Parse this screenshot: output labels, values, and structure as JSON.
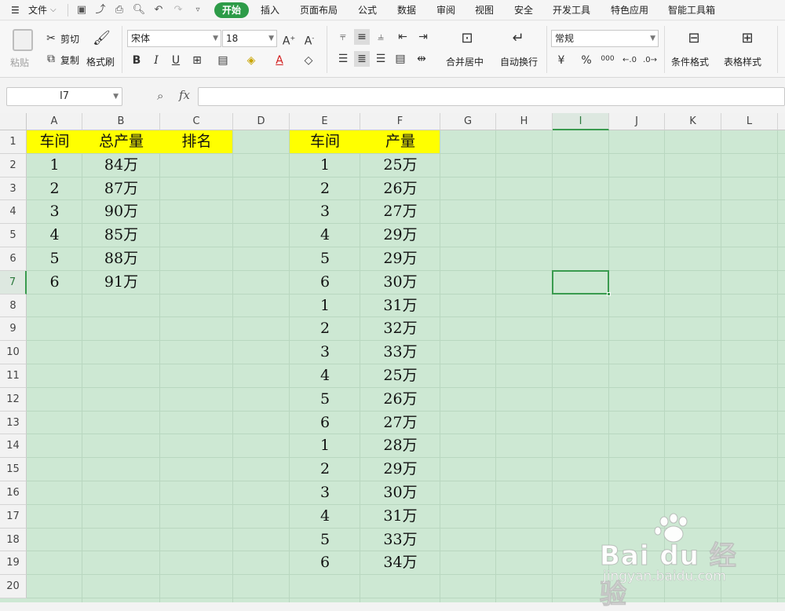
{
  "menu": {
    "file": "文件",
    "tabs": [
      "开始",
      "插入",
      "页面布局",
      "公式",
      "数据",
      "审阅",
      "视图",
      "安全",
      "开发工具",
      "特色应用",
      "智能工具箱"
    ],
    "active_tab": "开始"
  },
  "ribbon": {
    "paste": "粘贴",
    "cut": "剪切",
    "copy": "复制",
    "format_painter": "格式刷",
    "font_name": "宋体",
    "font_size": "18",
    "bold": "B",
    "italic": "I",
    "underline": "U",
    "merge_center": "合并居中",
    "wrap_text": "自动换行",
    "number_format": "常规",
    "percent": "%",
    "thousands": "000",
    "conditional_format": "条件格式",
    "table_style": "表格样式"
  },
  "formula_bar": {
    "name_box": "I7",
    "fx": "fx",
    "content": ""
  },
  "sheet": {
    "columns": [
      "A",
      "B",
      "C",
      "D",
      "E",
      "F",
      "G",
      "H",
      "I",
      "J",
      "K",
      "L"
    ],
    "rows": [
      "1",
      "2",
      "3",
      "4",
      "5",
      "6",
      "7",
      "8",
      "9",
      "10",
      "11",
      "12",
      "13",
      "14",
      "15",
      "16",
      "17",
      "18",
      "19",
      "20"
    ],
    "selected_column": "I",
    "selected_row": "7",
    "header_fill_color": "#ffff00",
    "grid_fill_color": "#cde8d3",
    "table1": {
      "headers": [
        "车间",
        "总产量",
        "排名"
      ],
      "rows": [
        [
          "1",
          "84万",
          ""
        ],
        [
          "2",
          "87万",
          ""
        ],
        [
          "3",
          "90万",
          ""
        ],
        [
          "4",
          "85万",
          ""
        ],
        [
          "5",
          "88万",
          ""
        ],
        [
          "6",
          "91万",
          ""
        ]
      ]
    },
    "table2": {
      "headers": [
        "车间",
        "产量"
      ],
      "rows": [
        [
          "1",
          "25万"
        ],
        [
          "2",
          "26万"
        ],
        [
          "3",
          "27万"
        ],
        [
          "4",
          "29万"
        ],
        [
          "5",
          "29万"
        ],
        [
          "6",
          "30万"
        ],
        [
          "1",
          "31万"
        ],
        [
          "2",
          "32万"
        ],
        [
          "3",
          "33万"
        ],
        [
          "4",
          "25万"
        ],
        [
          "5",
          "26万"
        ],
        [
          "6",
          "27万"
        ],
        [
          "1",
          "28万"
        ],
        [
          "2",
          "29万"
        ],
        [
          "3",
          "30万"
        ],
        [
          "4",
          "31万"
        ],
        [
          "5",
          "33万"
        ],
        [
          "6",
          "34万"
        ]
      ]
    }
  },
  "watermark": {
    "logo_text": "Bai du 经验",
    "url": "jingyan.baidu.com"
  }
}
